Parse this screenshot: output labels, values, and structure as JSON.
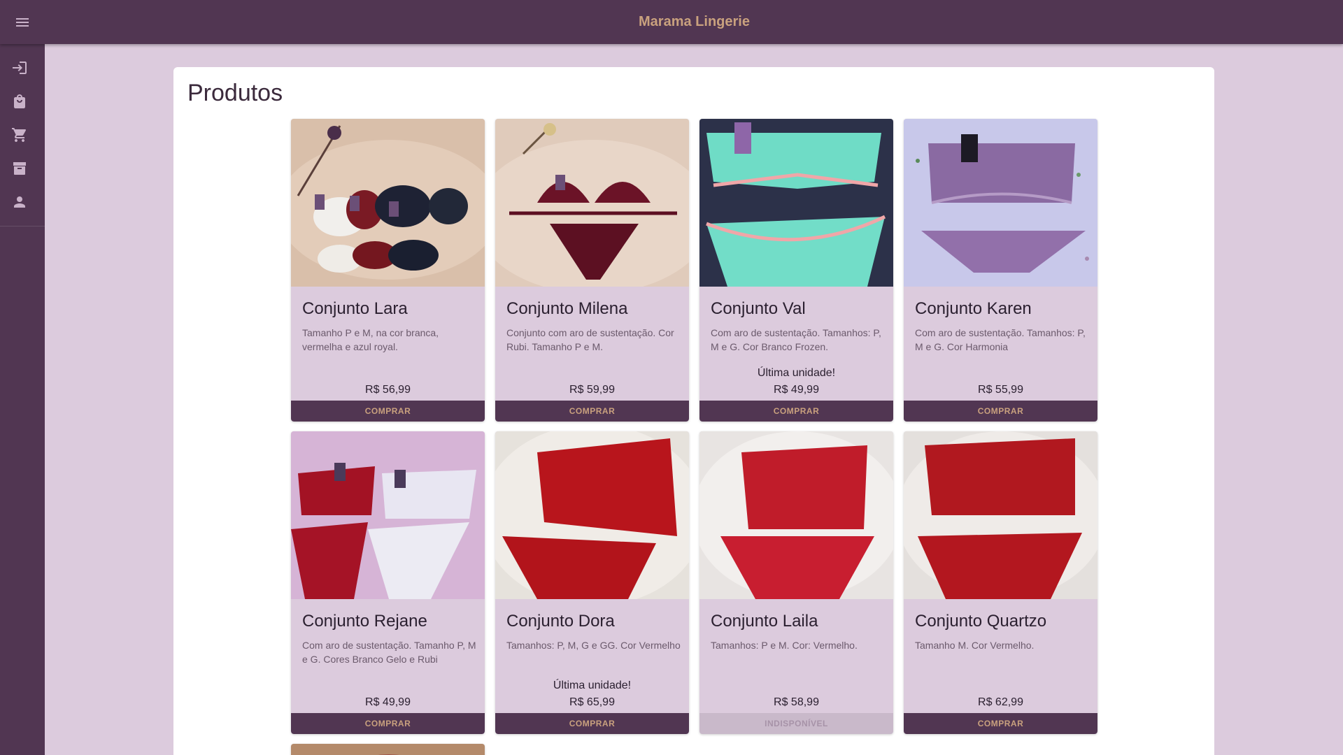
{
  "header": {
    "title": "Marama Lingerie",
    "menu_icon": "menu-icon"
  },
  "sidebar": {
    "items": [
      {
        "name": "login",
        "icon": "login-icon"
      },
      {
        "name": "shopping-bag",
        "icon": "shopping-bag-icon"
      },
      {
        "name": "cart",
        "icon": "cart-icon"
      },
      {
        "name": "archive",
        "icon": "archive-icon"
      },
      {
        "name": "account",
        "icon": "person-icon"
      }
    ]
  },
  "main": {
    "title": "Produtos",
    "products": [
      {
        "name": "Conjunto Lara",
        "desc": "Tamanho P e M, na cor branca, vermelha e azul royal.",
        "note": "",
        "price": "R$ 56,99",
        "action": "COMPRAR",
        "available": true
      },
      {
        "name": "Conjunto Milena",
        "desc": "Conjunto com aro de sustentação. Cor Rubi. Tamanho P e M.",
        "note": "",
        "price": "R$ 59,99",
        "action": "COMPRAR",
        "available": true
      },
      {
        "name": "Conjunto Val",
        "desc": "Com aro de sustentação. Tamanhos: P, M e G. Cor Branco Frozen.",
        "note": "Última unidade!",
        "price": "R$ 49,99",
        "action": "COMPRAR",
        "available": true
      },
      {
        "name": "Conjunto Karen",
        "desc": "Com aro de sustentação. Tamanhos: P, M e G. Cor Harmonia",
        "note": "",
        "price": "R$ 55,99",
        "action": "COMPRAR",
        "available": true
      },
      {
        "name": "Conjunto Rejane",
        "desc": "Com aro de sustentação. Tamanho P, M e G. Cores Branco Gelo e Rubi",
        "note": "",
        "price": "R$ 49,99",
        "action": "COMPRAR",
        "available": true
      },
      {
        "name": "Conjunto Dora",
        "desc": "Tamanhos: P, M, G e GG. Cor Vermelho",
        "note": "Última unidade!",
        "price": "R$ 65,99",
        "action": "COMPRAR",
        "available": true
      },
      {
        "name": "Conjunto Laila",
        "desc": "Tamanhos: P e M. Cor: Vermelho.",
        "note": "",
        "price": "R$ 58,99",
        "action": "INDISPONÍVEL",
        "available": false
      },
      {
        "name": "Conjunto Quartzo",
        "desc": "Tamanho M. Cor Vermelho.",
        "note": "",
        "price": "R$ 62,99",
        "action": "COMPRAR",
        "available": true
      }
    ]
  },
  "colors": {
    "primary": "#513652",
    "accent": "#c9a17e",
    "background": "#dccbdd",
    "card": "#dccbdd"
  }
}
